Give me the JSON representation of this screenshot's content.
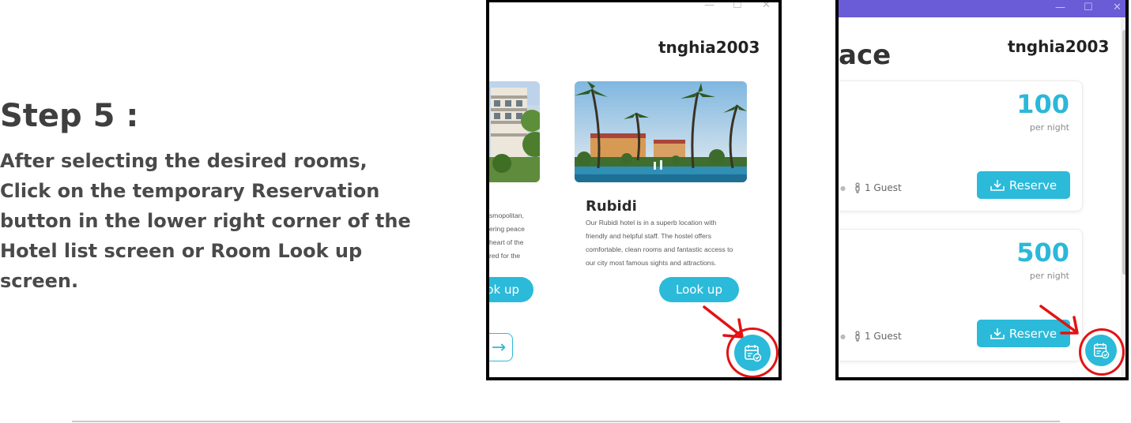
{
  "step": {
    "title": "Step 5 :",
    "lines": [
      "After selecting the desired rooms,",
      "Click on the temporary Reservation",
      "button in the lower right corner of the",
      "Hotel list screen or Room Look up",
      "screen."
    ]
  },
  "hotel_list": {
    "window_controls": {
      "minimize": "—",
      "maximize": "☐",
      "close": "✕"
    },
    "username": "tnghia2003",
    "left_card": {
      "desc_fragments": [
        "smopolitan,",
        "ering peace",
        "heart of the",
        "red for the"
      ],
      "look_up_partial": "ok up"
    },
    "card": {
      "name": "Rubidi",
      "description": [
        "Our Rubidi hotel is in a superb location with",
        "friendly and helpful staff. The hostel offers",
        "comfortable, clean rooms and fantastic access to",
        "our city most famous sights and attractions."
      ],
      "look_up_label": "Look up"
    },
    "next_arrow": "→",
    "fab_icon": "calendar-check-icon"
  },
  "room_lookup": {
    "window_controls": {
      "minimize": "—",
      "maximize": "☐",
      "close": "✕"
    },
    "title_partial": "ace",
    "username": "tnghia2003",
    "rooms": [
      {
        "price": "100",
        "per_night": "per night",
        "guests": "1 Guest",
        "reserve_label": "Reserve"
      },
      {
        "price": "500",
        "per_night": "per night",
        "guests": "1 Guest",
        "reserve_label": "Reserve"
      }
    ],
    "fab_icon": "calendar-check-icon"
  },
  "colors": {
    "accent": "#2bbad9",
    "highlight": "#e31212",
    "titlebar": "#6a5bd6"
  }
}
